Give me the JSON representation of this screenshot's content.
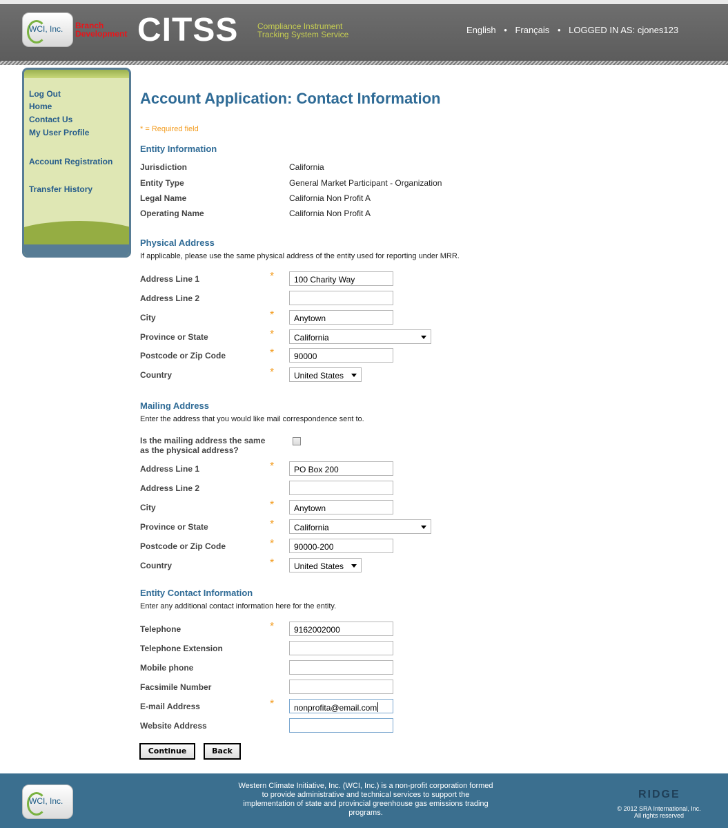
{
  "header": {
    "logo_text": "WCI, Inc.",
    "branch_line1": "Branch",
    "branch_line2": "Development",
    "app_name": "CITSS",
    "app_sub_line1": "Compliance Instrument",
    "app_sub_line2": "Tracking System Service",
    "lang_english": "English",
    "lang_french": "Français",
    "logged_in_label": "LOGGED IN AS:",
    "username": "cjones123",
    "separator": "•"
  },
  "sidebar": {
    "items": [
      {
        "label": "Log Out"
      },
      {
        "label": "Home"
      },
      {
        "label": "Contact Us"
      },
      {
        "label": "My User Profile"
      },
      {
        "label": "Account Registration"
      },
      {
        "label": "Transfer History"
      }
    ]
  },
  "page": {
    "title": "Account Application: Contact Information",
    "required_note": "* = Required field",
    "required_marker": "*"
  },
  "entity": {
    "title": "Entity Information",
    "rows": [
      {
        "label": "Jurisdiction",
        "value": "California"
      },
      {
        "label": "Entity Type",
        "value": "General Market Participant - Organization"
      },
      {
        "label": "Legal Name",
        "value": "California Non Profit A"
      },
      {
        "label": "Operating Name",
        "value": "California Non Profit A"
      }
    ]
  },
  "physical": {
    "title": "Physical Address",
    "description": "If applicable, please use the same physical address of the entity used for reporting under MRR.",
    "address1_label": "Address Line 1",
    "address1_value": "100 Charity Way",
    "address2_label": "Address Line 2",
    "address2_value": "",
    "city_label": "City",
    "city_value": "Anytown",
    "state_label": "Province or State",
    "state_value": "California",
    "zip_label": "Postcode or Zip Code",
    "zip_value": "90000",
    "country_label": "Country",
    "country_value": "United States"
  },
  "mailing": {
    "title": "Mailing Address",
    "description": "Enter the address that you would like mail correspondence sent to.",
    "same_label_line1": "Is the mailing address the same",
    "same_label_line2": "as the physical address?",
    "same_checked": false,
    "address1_label": "Address Line 1",
    "address1_value": "PO Box 200",
    "address2_label": "Address Line 2",
    "address2_value": "",
    "city_label": "City",
    "city_value": "Anytown",
    "state_label": "Province or State",
    "state_value": "California",
    "zip_label": "Postcode or Zip Code",
    "zip_value": "90000-200",
    "country_label": "Country",
    "country_value": "United States"
  },
  "contact": {
    "title": "Entity Contact Information",
    "description": "Enter any additional contact information here for the entity.",
    "telephone_label": "Telephone",
    "telephone_value": "9162002000",
    "extension_label": "Telephone Extension",
    "extension_value": "",
    "mobile_label": "Mobile phone",
    "mobile_value": "",
    "fax_label": "Facsimile Number",
    "fax_value": "",
    "email_label": "E-mail Address",
    "email_value": "nonprofita@email.com",
    "website_label": "Website Address",
    "website_value": ""
  },
  "buttons": {
    "continue": "Continue",
    "back": "Back"
  },
  "footer": {
    "logo_text": "WCI, Inc.",
    "line1": "Western Climate Initiative, Inc. (WCI, Inc.) is a non-profit corporation formed",
    "line2": "to provide administrative and technical services to support the",
    "line3": "implementation of state and provincial greenhouse gas emissions trading",
    "line4": "programs.",
    "ridge_logo": "RIDGE",
    "copyright_line1": "© 2012 SRA International, Inc.",
    "copyright_line2": "All rights reserved"
  }
}
